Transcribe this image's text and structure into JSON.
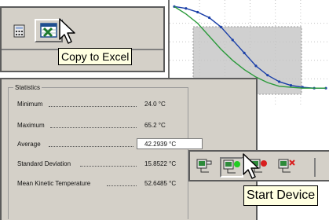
{
  "excel_toolbar": {
    "icons": [
      "calculator-icon",
      "excel-icon"
    ],
    "tooltip": "Copy to Excel"
  },
  "statistics": {
    "group_title": "Statistics",
    "rows": [
      {
        "label": "Minimum",
        "value": "24.0 °C"
      },
      {
        "label": "Maximum",
        "value": "65.2 °C"
      },
      {
        "label": "Average",
        "value": "42.2939 °C"
      },
      {
        "label": "Standard Deviation",
        "value": "15.8522 °C"
      },
      {
        "label": "Mean Kinetic Temperature",
        "value": "52.6485 °C"
      }
    ]
  },
  "device_toolbar": {
    "icons": [
      "device-settings-icon",
      "start-device-icon",
      "stop-device-icon",
      "clear-device-icon"
    ],
    "tooltip": "Start Device"
  },
  "chart_data": {
    "type": "line",
    "series": [
      {
        "values": [
          98,
          96,
          92,
          86,
          76,
          62,
          48,
          34,
          24,
          17,
          13,
          11,
          10,
          10
        ]
      },
      {
        "values": [
          98,
          90,
          80,
          66,
          52,
          40,
          30,
          22,
          16,
          12,
          11,
          10,
          10,
          10
        ]
      }
    ],
    "selection_visible": true,
    "grid": true
  },
  "colors": {
    "panel_bg": "#d4d0c8",
    "tooltip_bg": "#ffffe1",
    "series_blue": "#1a3fa8",
    "series_green": "#2a9a3a"
  }
}
